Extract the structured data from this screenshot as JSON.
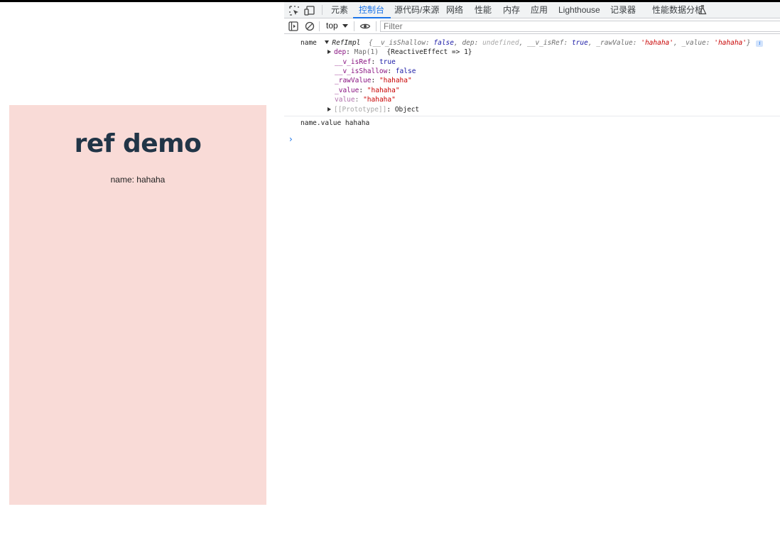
{
  "app": {
    "title": "ref demo",
    "name_line": "name: hahaha"
  },
  "devtools": {
    "tabs": [
      {
        "label": "元素",
        "active": false
      },
      {
        "label": "控制台",
        "active": true
      },
      {
        "label": "源代码/来源",
        "active": false
      },
      {
        "label": "网络",
        "active": false
      },
      {
        "label": "性能",
        "active": false
      },
      {
        "label": "内存",
        "active": false
      },
      {
        "label": "应用",
        "active": false
      },
      {
        "label": "Lighthouse",
        "active": false
      },
      {
        "label": "记录器",
        "active": false
      },
      {
        "label": "性能数据分析",
        "active": false
      }
    ],
    "toolbar": {
      "context": "top",
      "filter_placeholder": "Filter"
    },
    "colors": {
      "accent": "#1a73e8",
      "panel_bg": "#f9dbd7",
      "title_color": "#213547"
    },
    "console": {
      "log1": {
        "label": "name",
        "class_name": "RefImpl",
        "preview": {
          "open": "{",
          "k1": "__v_isShallow",
          "v1": "false",
          "k2": "dep",
          "v2": "undefined",
          "k3": "__v_isRef",
          "v3": "true",
          "k4": "_rawValue",
          "v4": "'hahaha'",
          "k5": "_value",
          "v5": "'hahaha'",
          "close": "}",
          "info": "i"
        },
        "props": {
          "dep_key": "dep",
          "dep_val": "Map(1)",
          "dep_entry": "{ReactiveEffect => 1}",
          "isref_key": "__v_isRef",
          "isref_val": "true",
          "isshallow_key": "__v_isShallow",
          "isshallow_val": "false",
          "rawvalue_key": "_rawValue",
          "rawvalue_val": "\"hahaha\"",
          "value_key": "_value",
          "value_val": "\"hahaha\"",
          "getter_key": "value",
          "getter_val": "\"hahaha\"",
          "proto_key": "[[Prototype]]",
          "proto_val": "Object"
        }
      },
      "log2": "name.value hahaha",
      "prompt": "›"
    }
  }
}
